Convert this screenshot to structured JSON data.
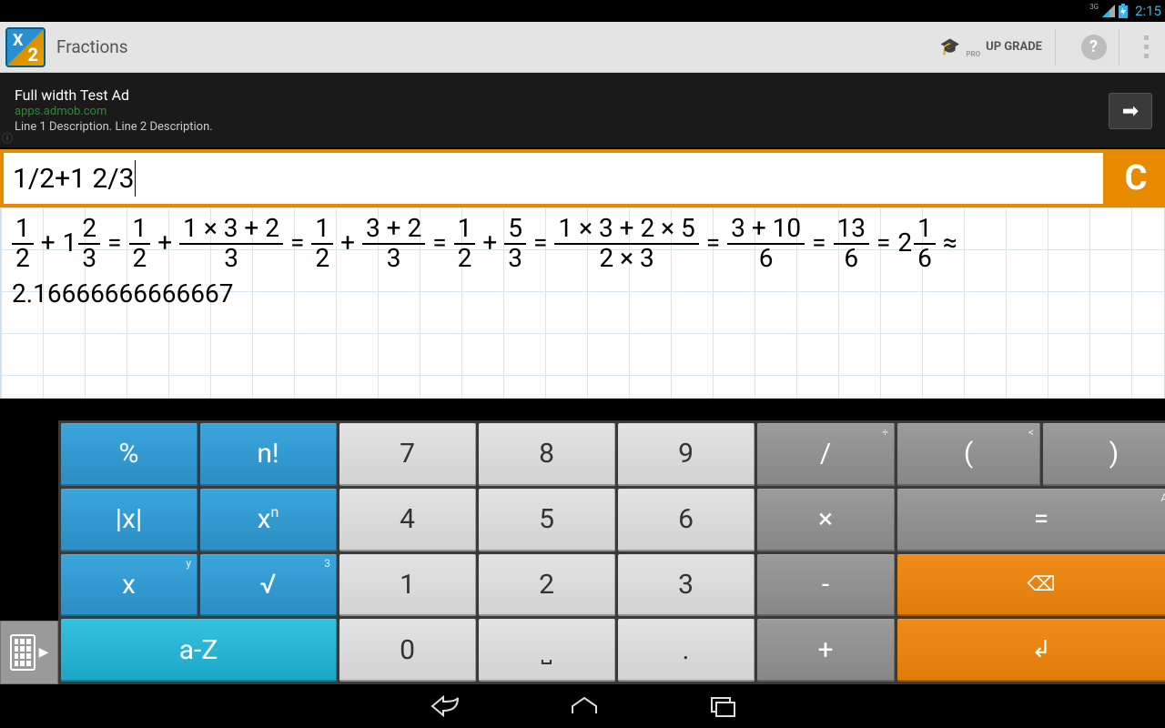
{
  "statusbar": {
    "network": "3G",
    "time": "2:15"
  },
  "appbar": {
    "title": "Fractions",
    "upgrade_label": "UP GRADE",
    "upgrade_caption": "PRO",
    "help_label": "?"
  },
  "ad": {
    "title": "Full width Test Ad",
    "url": "apps.admob.com",
    "description": "Line 1 Description. Line 2 Description.",
    "info": "ⓘ"
  },
  "input": {
    "expression": "1/2+1 2/3",
    "clear_label": "C"
  },
  "result": {
    "steps": [
      {
        "type": "frac",
        "n": "1",
        "d": "2"
      },
      {
        "type": "op",
        "v": "+"
      },
      {
        "type": "mixed",
        "whole": "1",
        "n": "2",
        "d": "3"
      },
      {
        "type": "op",
        "v": "="
      },
      {
        "type": "frac",
        "n": "1",
        "d": "2"
      },
      {
        "type": "op",
        "v": "+"
      },
      {
        "type": "frac",
        "n": "1 × 3 + 2",
        "d": "3"
      },
      {
        "type": "op",
        "v": "="
      },
      {
        "type": "frac",
        "n": "1",
        "d": "2"
      },
      {
        "type": "op",
        "v": "+"
      },
      {
        "type": "frac",
        "n": "3 + 2",
        "d": "3"
      },
      {
        "type": "op",
        "v": "="
      },
      {
        "type": "frac",
        "n": "1",
        "d": "2"
      },
      {
        "type": "op",
        "v": "+"
      },
      {
        "type": "frac",
        "n": "5",
        "d": "3"
      },
      {
        "type": "op",
        "v": "="
      },
      {
        "type": "frac",
        "n": "1 × 3 + 2 × 5",
        "d": "2 × 3"
      },
      {
        "type": "op",
        "v": "="
      },
      {
        "type": "frac",
        "n": "3 + 10",
        "d": "6"
      },
      {
        "type": "op",
        "v": "="
      },
      {
        "type": "frac",
        "n": "13",
        "d": "6"
      },
      {
        "type": "op",
        "v": "="
      },
      {
        "type": "mixed",
        "whole": "2",
        "n": "1",
        "d": "6"
      },
      {
        "type": "op",
        "v": "≈"
      }
    ],
    "approx": "2.16666666666667"
  },
  "keypad": {
    "rows": [
      [
        {
          "label": "%",
          "style": "blue",
          "name": "key-percent"
        },
        {
          "label": "n!",
          "style": "blue",
          "name": "key-factorial"
        },
        {
          "label": "7",
          "style": "light",
          "name": "key-7"
        },
        {
          "label": "8",
          "style": "light",
          "name": "key-8"
        },
        {
          "label": "9",
          "style": "light",
          "name": "key-9"
        },
        {
          "label": "/",
          "style": "grey",
          "name": "key-divide",
          "hint": "÷"
        },
        {
          "label": "(",
          "style": "grey",
          "name": "key-lparen",
          "hint": "<"
        },
        {
          "label": ")",
          "style": "grey",
          "name": "key-rparen",
          "hint": ">"
        }
      ],
      [
        {
          "label": "|x|",
          "style": "blue",
          "name": "key-abs"
        },
        {
          "label": "xⁿ",
          "style": "blue",
          "name": "key-power"
        },
        {
          "label": "4",
          "style": "light",
          "name": "key-4"
        },
        {
          "label": "5",
          "style": "light",
          "name": "key-5"
        },
        {
          "label": "6",
          "style": "light",
          "name": "key-6"
        },
        {
          "label": "×",
          "style": "grey",
          "name": "key-multiply"
        },
        {
          "label": "=",
          "style": "grey",
          "name": "key-equals-op",
          "span": 2,
          "hint": "Ans"
        }
      ],
      [
        {
          "label": "x",
          "style": "blue",
          "name": "key-var-x",
          "hint": "y"
        },
        {
          "label": "√",
          "style": "blue",
          "name": "key-sqrt",
          "hint": "3"
        },
        {
          "label": "1",
          "style": "light",
          "name": "key-1"
        },
        {
          "label": "2",
          "style": "light",
          "name": "key-2"
        },
        {
          "label": "3",
          "style": "light",
          "name": "key-3"
        },
        {
          "label": "-",
          "style": "grey",
          "name": "key-minus"
        },
        {
          "label": "⌫",
          "style": "orange",
          "name": "key-backspace",
          "span": 2
        }
      ],
      [
        {
          "label": "a-Z",
          "style": "cyan",
          "name": "key-alpha",
          "span": 2
        },
        {
          "label": "0",
          "style": "light",
          "name": "key-0"
        },
        {
          "label": "␣",
          "style": "light",
          "name": "key-space"
        },
        {
          "label": ".",
          "style": "light",
          "name": "key-dot"
        },
        {
          "label": "+",
          "style": "grey",
          "name": "key-plus"
        },
        {
          "label": "↵",
          "style": "orange",
          "name": "key-enter",
          "span": 2
        }
      ]
    ]
  }
}
